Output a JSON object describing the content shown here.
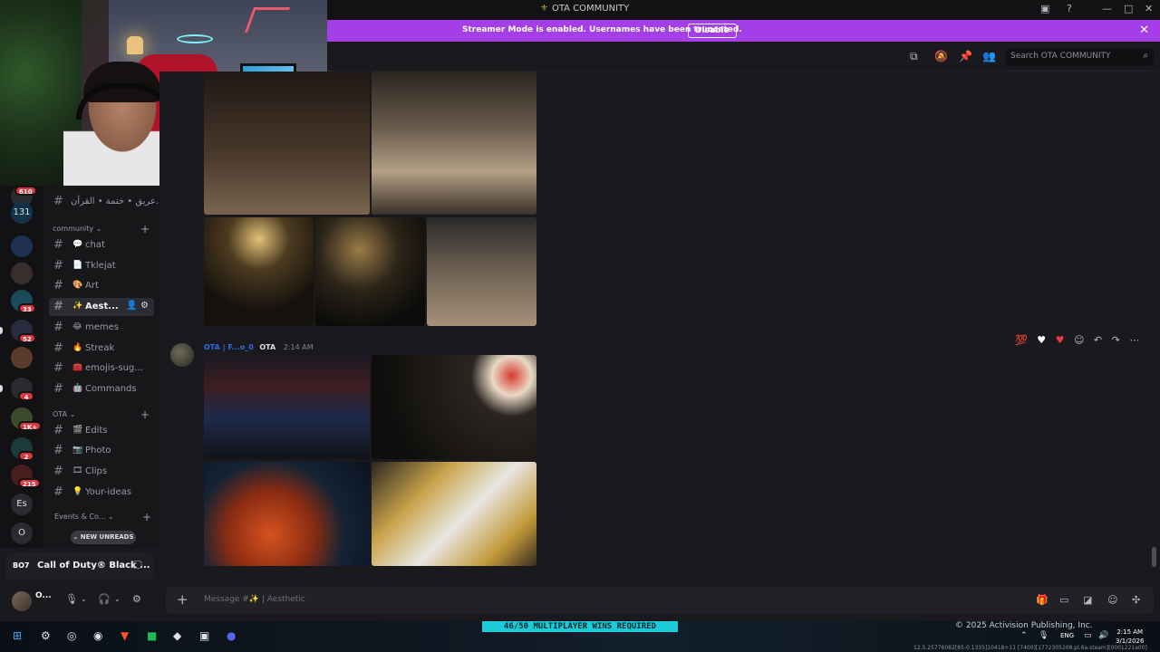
{
  "window": {
    "title": "OTA COMMUNITY"
  },
  "banner": {
    "message": "Streamer Mode is enabled. Usernames have been truncated.",
    "disable_label": "Disable"
  },
  "header": {
    "search_placeholder": "Search OTA COMMUNITY"
  },
  "servers": [
    {
      "label": "",
      "badge": "610"
    },
    {
      "label": "131",
      "badge": ""
    },
    {
      "label": "",
      "badge": ""
    },
    {
      "label": "",
      "badge": ""
    },
    {
      "label": "",
      "badge": "33"
    },
    {
      "label": "",
      "badge": "52"
    },
    {
      "label": "",
      "badge": ""
    },
    {
      "label": "",
      "badge": "4"
    },
    {
      "label": "",
      "badge": "1K+"
    },
    {
      "label": "",
      "badge": "2"
    },
    {
      "label": "",
      "badge": "215"
    },
    {
      "label": "Es",
      "badge": ""
    },
    {
      "label": "O",
      "badge": ""
    }
  ],
  "channels": {
    "top_channel": "عريق • ختمة • القرآن...",
    "categories": [
      {
        "name": "community",
        "items": [
          {
            "emoji": "💬",
            "name": "chat"
          },
          {
            "emoji": "📄",
            "name": "Tklejat"
          },
          {
            "emoji": "🎨",
            "name": "Art"
          },
          {
            "emoji": "✨",
            "name": "Aest...",
            "active": true
          },
          {
            "emoji": "😂",
            "name": "memes"
          },
          {
            "emoji": "🔥",
            "name": "Streak"
          },
          {
            "emoji": "🧰",
            "name": "emojis-sug..."
          },
          {
            "emoji": "🤖",
            "name": "Commands"
          }
        ]
      },
      {
        "name": "OTA",
        "items": [
          {
            "emoji": "🎬",
            "name": "Edits"
          },
          {
            "emoji": "📷",
            "name": "Photo"
          },
          {
            "emoji": "🎞",
            "name": "Clips"
          },
          {
            "emoji": "💡",
            "name": "Your-ideas"
          }
        ]
      },
      {
        "name": "Events & Co...",
        "items": []
      }
    ],
    "new_unreads": "NEW UNREADS"
  },
  "activity": {
    "game": "Call of Duty® Black ...",
    "logo_text": "BO7"
  },
  "user": {
    "name": "O..."
  },
  "message": {
    "author": "OTA | F...o_0",
    "tag": "OTA",
    "time": "2:14 AM"
  },
  "composer": {
    "placeholder": "Message #✨ | Aesthetic"
  },
  "taskbar": {
    "game_banner": "46/50 MULTIPLAYER WINS REQUIRED",
    "copyright": "© 2025 Activision Publishing, Inc.",
    "time": "2:15 AM",
    "date": "3/1/2026",
    "lang": "ENG",
    "build": "12.5.25776082[85-0.1335]10418+11 [7400][1772305208.pl.6a.steam][0001221a00]"
  },
  "colors": {
    "accent": "#a43fe7",
    "link": "#2f6fe0",
    "badge": "#da373c",
    "cod_banner": "#1ccbd8"
  }
}
